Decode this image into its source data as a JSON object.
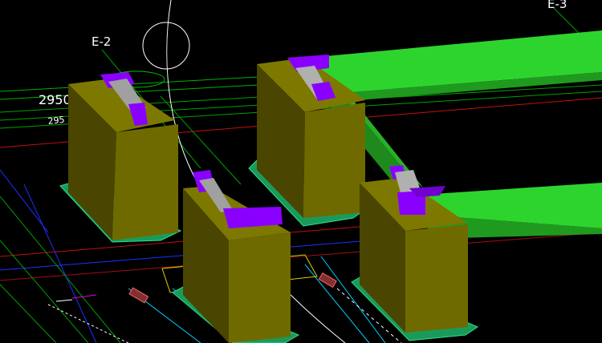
{
  "viewport": {
    "grid_labels": {
      "e2": "E-2",
      "e3": "E-3"
    },
    "dimensions": {
      "primary": "2950",
      "secondary": "295"
    }
  },
  "colors": {
    "background": "#000000",
    "pedestal_front": "#6f6a00",
    "pedestal_side": "#4a4500",
    "pedestal_top": "#7d7800",
    "bearing_plate": "#8a00ff",
    "bearing_pad": "#b0b0b0",
    "beam_top": "#2fd42f",
    "beam_side": "#1f8f1f",
    "footing": "#2ee08a",
    "grid_green": "#00c000",
    "grid_red": "#d01010",
    "grid_blue": "#2030ff",
    "grid_cyan": "#00d8ff",
    "grid_white": "#ffffff",
    "grid_yellow": "#e0d000"
  }
}
